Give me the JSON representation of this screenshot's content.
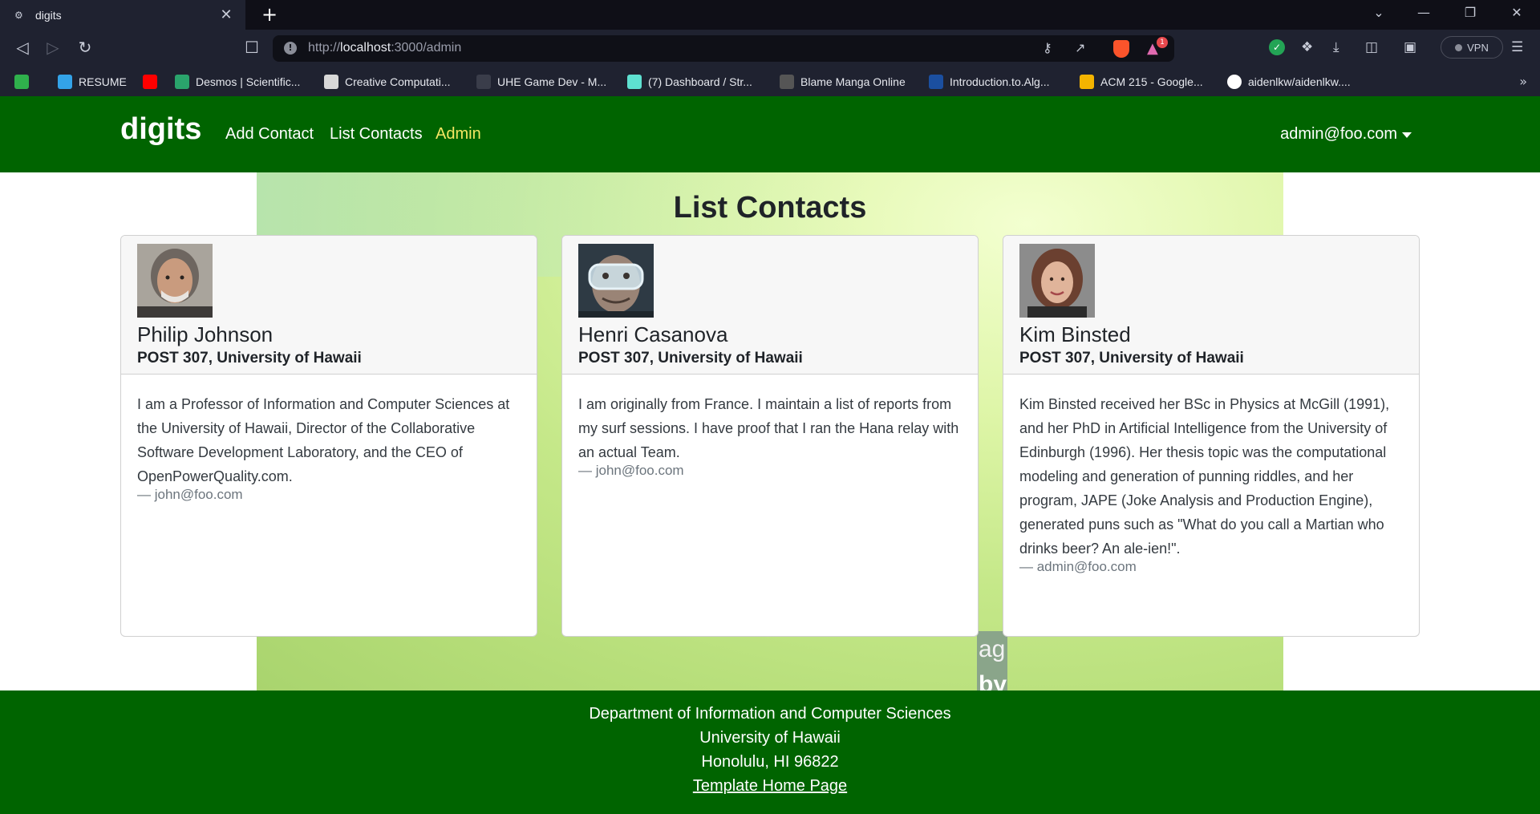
{
  "browser": {
    "tab_title": "digits",
    "tab_close": "✕",
    "new_tab": "+",
    "url_prefix": "http://",
    "url_host": "localhost",
    "url_rest": ":3000/admin",
    "vpn_label": "VPN",
    "notification_count": "1",
    "bookmarks": [
      {
        "label": "",
        "icon": "check-icon",
        "color": "#2fb14c"
      },
      {
        "label": "RESUME",
        "icon": "n-icon",
        "color": "#33a3e8"
      },
      {
        "label": "",
        "icon": "youtube-icon",
        "color": "#ff0000"
      },
      {
        "label": "Desmos | Scientific...",
        "icon": "desmos-icon",
        "color": "#2aa46c"
      },
      {
        "label": "Creative Computati...",
        "icon": "creative-icon",
        "color": "#d8d8d8"
      },
      {
        "label": "UHE Game Dev - M...",
        "icon": "uhe-icon",
        "color": "#c8ccd8"
      },
      {
        "label": "(7) Dashboard / Str...",
        "icon": "discord-icon",
        "color": "#5ee0d0"
      },
      {
        "label": "Blame Manga Online",
        "icon": "manga-icon",
        "color": "#888888"
      },
      {
        "label": "Introduction.to.Alg...",
        "icon": "book-icon",
        "color": "#1b4fa0"
      },
      {
        "label": "ACM 215 - Google...",
        "icon": "drive-icon",
        "color": "#f4b400"
      },
      {
        "label": "aidenlkw/aidenlkw....",
        "icon": "github-icon",
        "color": "#ffffff"
      }
    ]
  },
  "nav": {
    "brand": "digits",
    "links": [
      "Add Contact",
      "List Contacts",
      "Admin"
    ],
    "user": "admin@foo.com"
  },
  "main": {
    "heading": "List Contacts",
    "bg_text_1": "ag",
    "bg_text_2": "by"
  },
  "contacts": [
    {
      "name": "Philip Johnson",
      "address": "POST 307, University of Hawaii",
      "description": "I am a Professor of Information and Computer Sciences at the University of Hawaii, Director of the Collaborative Software Development Laboratory, and the CEO of OpenPowerQuality.com.",
      "owner": "— john@foo.com"
    },
    {
      "name": "Henri Casanova",
      "address": "POST 307, University of Hawaii",
      "description": "I am originally from France. I maintain a list of reports from my surf sessions. I have proof that I ran the Hana relay with an actual Team.",
      "owner": "— john@foo.com"
    },
    {
      "name": "Kim Binsted",
      "address": "POST 307, University of Hawaii",
      "description": "Kim Binsted received her BSc in Physics at McGill (1991), and her PhD in Artificial Intelligence from the University of Edinburgh (1996). Her thesis topic was the computational modeling and generation of punning riddles, and her program, JAPE (Joke Analysis and Production Engine), generated puns such as \"What do you call a Martian who drinks beer? An ale-ien!\".",
      "owner": "— admin@foo.com"
    }
  ],
  "footer": {
    "line1": "Department of Information and Computer Sciences",
    "line2": "University of Hawaii",
    "line3": "Honolulu, HI 96822",
    "link": "Template Home Page"
  }
}
